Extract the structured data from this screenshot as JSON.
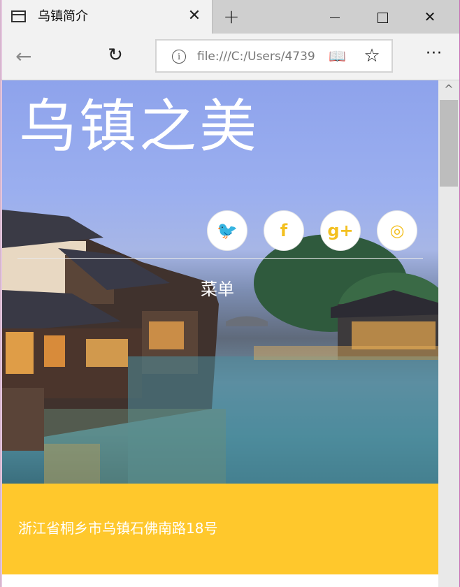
{
  "browser": {
    "tab_title": "乌镇简介",
    "tab_close": "✕",
    "new_tab": "+",
    "close_window": "✕",
    "back": "←",
    "refresh": "↻",
    "info": "i",
    "url": "file:///C:/Users/4739",
    "reading_view": "📖",
    "favorite": "☆",
    "more": "···"
  },
  "page": {
    "title": "乌镇之美",
    "social": [
      {
        "name": "twitter",
        "glyph": "🐦"
      },
      {
        "name": "facebook",
        "glyph": "f"
      },
      {
        "name": "google-plus",
        "glyph": "g+"
      },
      {
        "name": "dribbble",
        "glyph": "◎"
      }
    ],
    "menu_label": "菜单",
    "address": "浙江省桐乡市乌镇石佛南路18号"
  },
  "colors": {
    "accent": "#ffc82c",
    "social_icon": "#f3c020"
  }
}
